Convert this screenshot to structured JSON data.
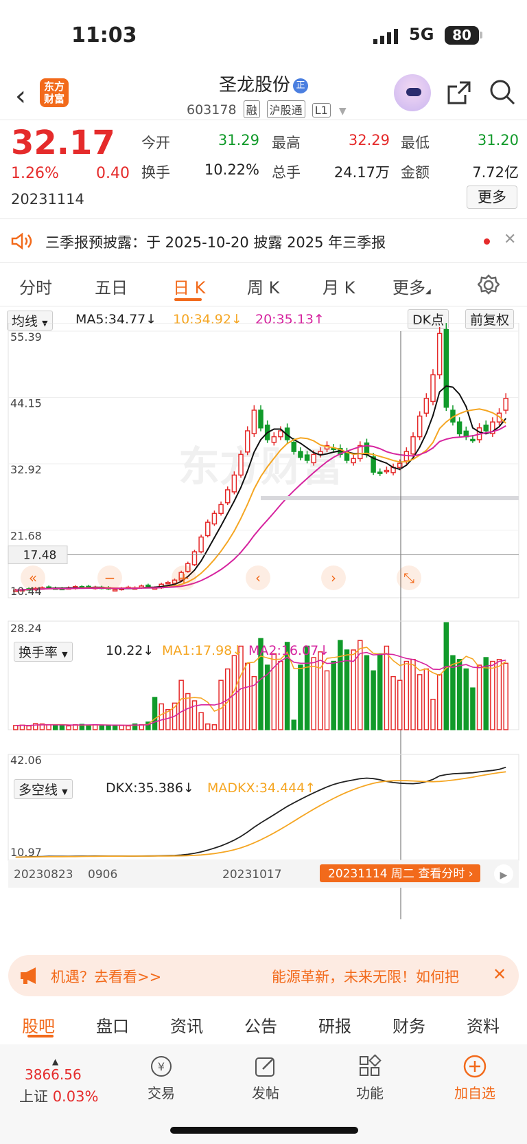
{
  "status": {
    "time": "11:03",
    "network": "5G",
    "battery": "80"
  },
  "header": {
    "app_logo": "东方\n财富",
    "name": "圣龙股份",
    "badge": "正",
    "code": "603178",
    "tags": [
      "融",
      "沪股通",
      "L1"
    ]
  },
  "quote": {
    "price": "32.17",
    "pct": "1.26%",
    "change": "0.40",
    "date": "20231114",
    "open_label": "今开",
    "open": "31.29",
    "high_label": "最高",
    "high": "32.29",
    "low_label": "最低",
    "low": "31.20",
    "turnover_label": "换手",
    "turnover": "10.22%",
    "volume_label": "总手",
    "volume": "24.17万",
    "amount_label": "金额",
    "amount": "7.72亿",
    "more": "更多"
  },
  "notice": {
    "text": "三季报预披露：于 2025-10-20 披露 2025 年三季报"
  },
  "tabs": [
    "分时",
    "五日",
    "日 K",
    "周 K",
    "月 K",
    "更多"
  ],
  "kline": {
    "selector": "均线",
    "ma5": "MA5:34.77↓",
    "ma10": "10:34.92↓",
    "ma20": "20:35.13↑",
    "dk": "DK点",
    "fq": "前复权",
    "y_ticks": [
      "55.39",
      "44.15",
      "32.92",
      "21.68",
      "10.44"
    ],
    "crosshair_value": "17.48",
    "watermark": "东方财富"
  },
  "turnover_panel": {
    "selector": "换手率",
    "value": "10.22↓",
    "ma1": "MA1:17.98↓",
    "ma2": "MA2:16.07↓",
    "y_top": "28.24"
  },
  "dkx_panel": {
    "selector": "多空线",
    "dkx": "DKX:35.386↓",
    "madkx": "MADKX:34.444↑",
    "y_top": "42.06",
    "y_bottom": "10.97"
  },
  "x_axis": {
    "labels": [
      "20230823",
      "0906",
      "20231017"
    ],
    "tooltip": "20231114 周二 查看分时"
  },
  "colors": {
    "up": "#e52b2b",
    "down": "#119a2a",
    "accent": "#f26a1b",
    "ma5": "#111111",
    "ma10": "#f5a623",
    "ma20": "#d6249f"
  },
  "ad": {
    "left": "机遇？去看看>>",
    "right": "能源革新，未来无限！如何把"
  },
  "bottom_tabs": [
    "股吧",
    "盘口",
    "资讯",
    "公告",
    "研报",
    "财务",
    "资料"
  ],
  "footer": {
    "index_value": "3866.56",
    "index_name": "上证",
    "index_pct": "0.03%",
    "trade": "交易",
    "post": "发帖",
    "func": "功能",
    "add": "加自选"
  },
  "chart_data": {
    "type": "candlestick",
    "title": "",
    "price_range": [
      10.44,
      55.39
    ],
    "turnover_range": [
      0,
      28.24
    ],
    "dkx_range": [
      10.97,
      42.06
    ],
    "price_series_approx": [
      11.5,
      11.6,
      11.7,
      11.8,
      11.9,
      12.0,
      11.8,
      11.7,
      11.9,
      12.1,
      12.0,
      11.9,
      12.0,
      11.8,
      11.7,
      11.6,
      11.8,
      12.0,
      11.9,
      12.2,
      12.0,
      11.9,
      12.5,
      12.8,
      13.2,
      14.5,
      16.0,
      18.0,
      20.5,
      23.0,
      24.5,
      26.0,
      28.5,
      31.0,
      34.5,
      38.5,
      42.0,
      39.0,
      37.0,
      37.5,
      38.5,
      37.0,
      35.0,
      34.0,
      33.5,
      34.5,
      35.0,
      36.0,
      35.5,
      34.5,
      33.5,
      33.8,
      36.0,
      34.5,
      31.5,
      31.3,
      31.8,
      32.3,
      33.0,
      35.0,
      37.5,
      41.0,
      44.0,
      48.0,
      55.0,
      42.5,
      40.0,
      38.0,
      37.5,
      37.0,
      39.0,
      38.5,
      40.0,
      41.5,
      44.0
    ],
    "turnover_approx": [
      1.1,
      1.2,
      1.0,
      1.6,
      1.5,
      1.3,
      1.2,
      1.2,
      1.0,
      1.3,
      1.4,
      1.2,
      1.3,
      1.1,
      1.2,
      1.2,
      1.1,
      1.0,
      1.5,
      1.3,
      2.0,
      8.5,
      6.8,
      5.3,
      7.0,
      13.0,
      9.5,
      7.6,
      4.5,
      1.5,
      1.3,
      13.0,
      16.0,
      19.5,
      22.0,
      17.5,
      14.0,
      24.0,
      17.0,
      20.0,
      18.0,
      23.0,
      2.5,
      17.0,
      22.0,
      19.0,
      20.5,
      15.5,
      18.0,
      23.5,
      21.0,
      21.0,
      23.5,
      19.5,
      15.5,
      20.0,
      22.0,
      14.0,
      13.0,
      18.0,
      18.5,
      14.5,
      16.0,
      8.0,
      14.5,
      28.2,
      19.5,
      18.5,
      16.0,
      11.0,
      17.0,
      19.0,
      18.0,
      18.5,
      17.5
    ]
  }
}
